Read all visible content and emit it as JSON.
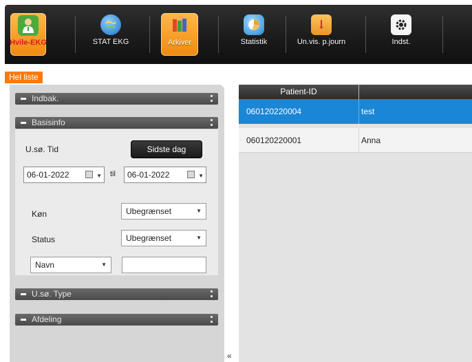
{
  "toolbar": {
    "items": [
      {
        "label": "Hvile-EKG",
        "icon": "doctor-icon"
      },
      {
        "label": "STAT EKG",
        "icon": "globe-icon"
      },
      {
        "label": "Arkiver",
        "icon": "archive-icon"
      },
      {
        "label": "Statistik",
        "icon": "pie-chart-icon"
      },
      {
        "label": "Un.vis. p.journ",
        "icon": "journal-icon"
      },
      {
        "label": "Indst.",
        "icon": "gear-icon"
      }
    ],
    "colors": {
      "active": "#f08a12",
      "background": "#1a1a1a"
    }
  },
  "tab": {
    "label": "Hel liste",
    "color": "#ff7a00"
  },
  "sections": {
    "indbak": "Indbak.",
    "basisinfo": "Basisinfo",
    "usotype": "U.sø. Type",
    "afdeling": "Afdeling"
  },
  "basisinfo": {
    "time_label": "U.sø. Tid",
    "last_day_button": "Sidste dag",
    "from_date": "06-01-2022",
    "til_label": "til",
    "to_date": "06-01-2022",
    "gender_label": "Køn",
    "gender_value": "Ubegrænset",
    "status_label": "Status",
    "status_value": "Ubegrænset",
    "name_select": "Navn",
    "name_input": ""
  },
  "grid": {
    "columns": [
      "Patient-ID",
      ""
    ],
    "rows": [
      {
        "id": "060120220004",
        "name": "test",
        "selected": true
      },
      {
        "id": "060120220001",
        "name": "Anna",
        "selected": false
      }
    ],
    "selected_color": "#1a86d6"
  },
  "collapse_glyph": "«"
}
